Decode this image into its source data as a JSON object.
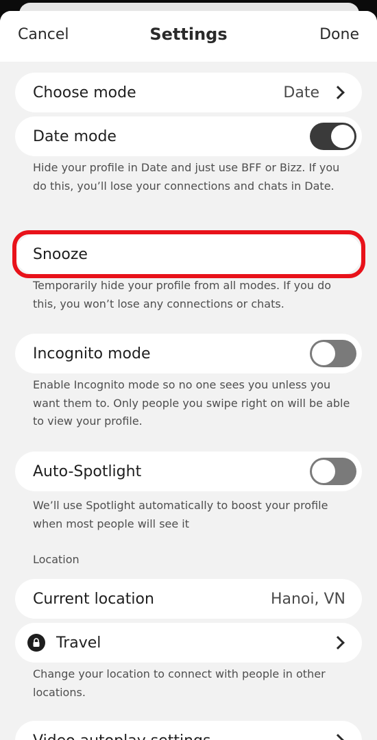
{
  "nav": {
    "cancel_label": "Cancel",
    "title": "Settings",
    "done_label": "Done"
  },
  "choose_mode": {
    "label": "Choose mode",
    "value": "Date"
  },
  "date_mode": {
    "label": "Date mode",
    "toggle_on": true,
    "description": "Hide your profile in Date and just use BFF or Bizz. If you do this, you’ll lose your connections and chats in Date."
  },
  "snooze": {
    "label": "Snooze",
    "description": "Temporarily hide your profile from all modes. If you do this, you won’t lose any connections or chats."
  },
  "incognito": {
    "label": "Incognito mode",
    "toggle_on": false,
    "description": "Enable Incognito mode so no one sees you unless you want them to. Only people you swipe right on will be able to view your profile."
  },
  "auto_spotlight": {
    "label": "Auto-Spotlight",
    "toggle_on": false,
    "description": "We’ll use Spotlight automatically to boost your profile when most people will see it"
  },
  "location": {
    "section_label": "Location",
    "current_label": "Current location",
    "current_value": "Hanoi, VN",
    "travel_label": "Travel",
    "travel_description": "Change your location to connect with people in other locations."
  },
  "video_autoplay": {
    "label": "Video autoplay settings"
  },
  "colors": {
    "highlight": "#e8121a",
    "toggle_on": "#3a3a3a",
    "toggle_off": "#7a7a7a"
  },
  "icons": {
    "chevron": "chevron-right-icon",
    "lock": "lock-icon"
  }
}
